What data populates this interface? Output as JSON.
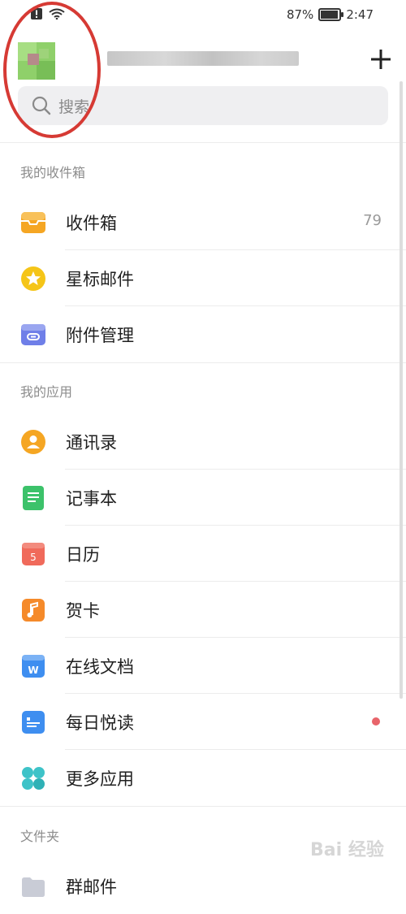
{
  "status_bar": {
    "battery": "87%",
    "time": "2:47",
    "battery_level": 0.87
  },
  "search": {
    "placeholder": "搜索"
  },
  "sections": {
    "mailbox": {
      "title": "我的收件箱",
      "items": [
        {
          "label": "收件箱",
          "count": "79",
          "icon": "inbox-icon",
          "color": "#f5a623"
        },
        {
          "label": "星标邮件",
          "icon": "star-icon",
          "color": "#f5c518"
        },
        {
          "label": "附件管理",
          "icon": "attachment-icon",
          "color": "#6f7fe8"
        }
      ]
    },
    "apps": {
      "title": "我的应用",
      "items": [
        {
          "label": "通讯录",
          "icon": "contacts-icon",
          "color": "#f5a623"
        },
        {
          "label": "记事本",
          "icon": "notebook-icon",
          "color": "#3cc26a"
        },
        {
          "label": "日历",
          "icon": "calendar-icon",
          "color": "#f06a5b",
          "badge_text": "5"
        },
        {
          "label": "贺卡",
          "icon": "greeting-card-icon",
          "color": "#f58a2a"
        },
        {
          "label": "在线文档",
          "icon": "online-doc-icon",
          "color": "#3e8ef0",
          "badge_text": "W"
        },
        {
          "label": "每日悦读",
          "icon": "daily-read-icon",
          "color": "#3e8ef0",
          "dot_color": "#e8646a"
        },
        {
          "label": "更多应用",
          "icon": "more-apps-icon",
          "color": "#3ec3c8"
        }
      ]
    },
    "folders": {
      "title": "文件夹",
      "items": [
        {
          "label": "群邮件",
          "icon": "folder-icon"
        }
      ]
    }
  },
  "watermark": "Bai 经验"
}
